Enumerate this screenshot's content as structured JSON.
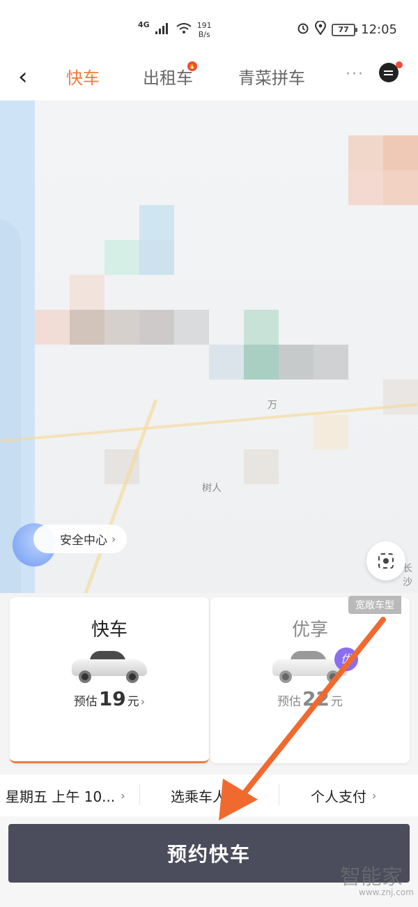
{
  "status_bar": {
    "network": "4G",
    "speed_value": "191",
    "speed_unit": "B/s",
    "battery": "77",
    "time": "12:05"
  },
  "nav": {
    "back_icon": "chevron-left-icon",
    "tabs": [
      {
        "label": "快车",
        "active": true
      },
      {
        "label": "出租车",
        "badge_icon": "fire-icon"
      },
      {
        "label": "青菜拼车"
      }
    ],
    "more": "···",
    "message_icon": "message-icon"
  },
  "map": {
    "safety_center": "安全中心",
    "label_1": "万",
    "label_2": "树人",
    "label_3": "长沙",
    "locate_icon": "locate-icon"
  },
  "cars": {
    "wide_tag": "宽敞车型",
    "items": [
      {
        "name": "快车",
        "price_prefix": "预估",
        "price": "19",
        "unit": "元",
        "selected": true
      },
      {
        "name": "优享",
        "price_prefix": "预估",
        "price": "22",
        "unit": "元",
        "badge": "优"
      }
    ]
  },
  "options": {
    "time": "星期五 上午 10...",
    "rider": "选乘车人",
    "payment": "个人支付"
  },
  "confirm_button": "预约快车",
  "watermark": {
    "brand": "智能家",
    "url": "www.znj.com"
  },
  "colors": {
    "accent": "#f07a3c",
    "button": "#4b4c5c",
    "badge_red": "#ee4a3a"
  }
}
